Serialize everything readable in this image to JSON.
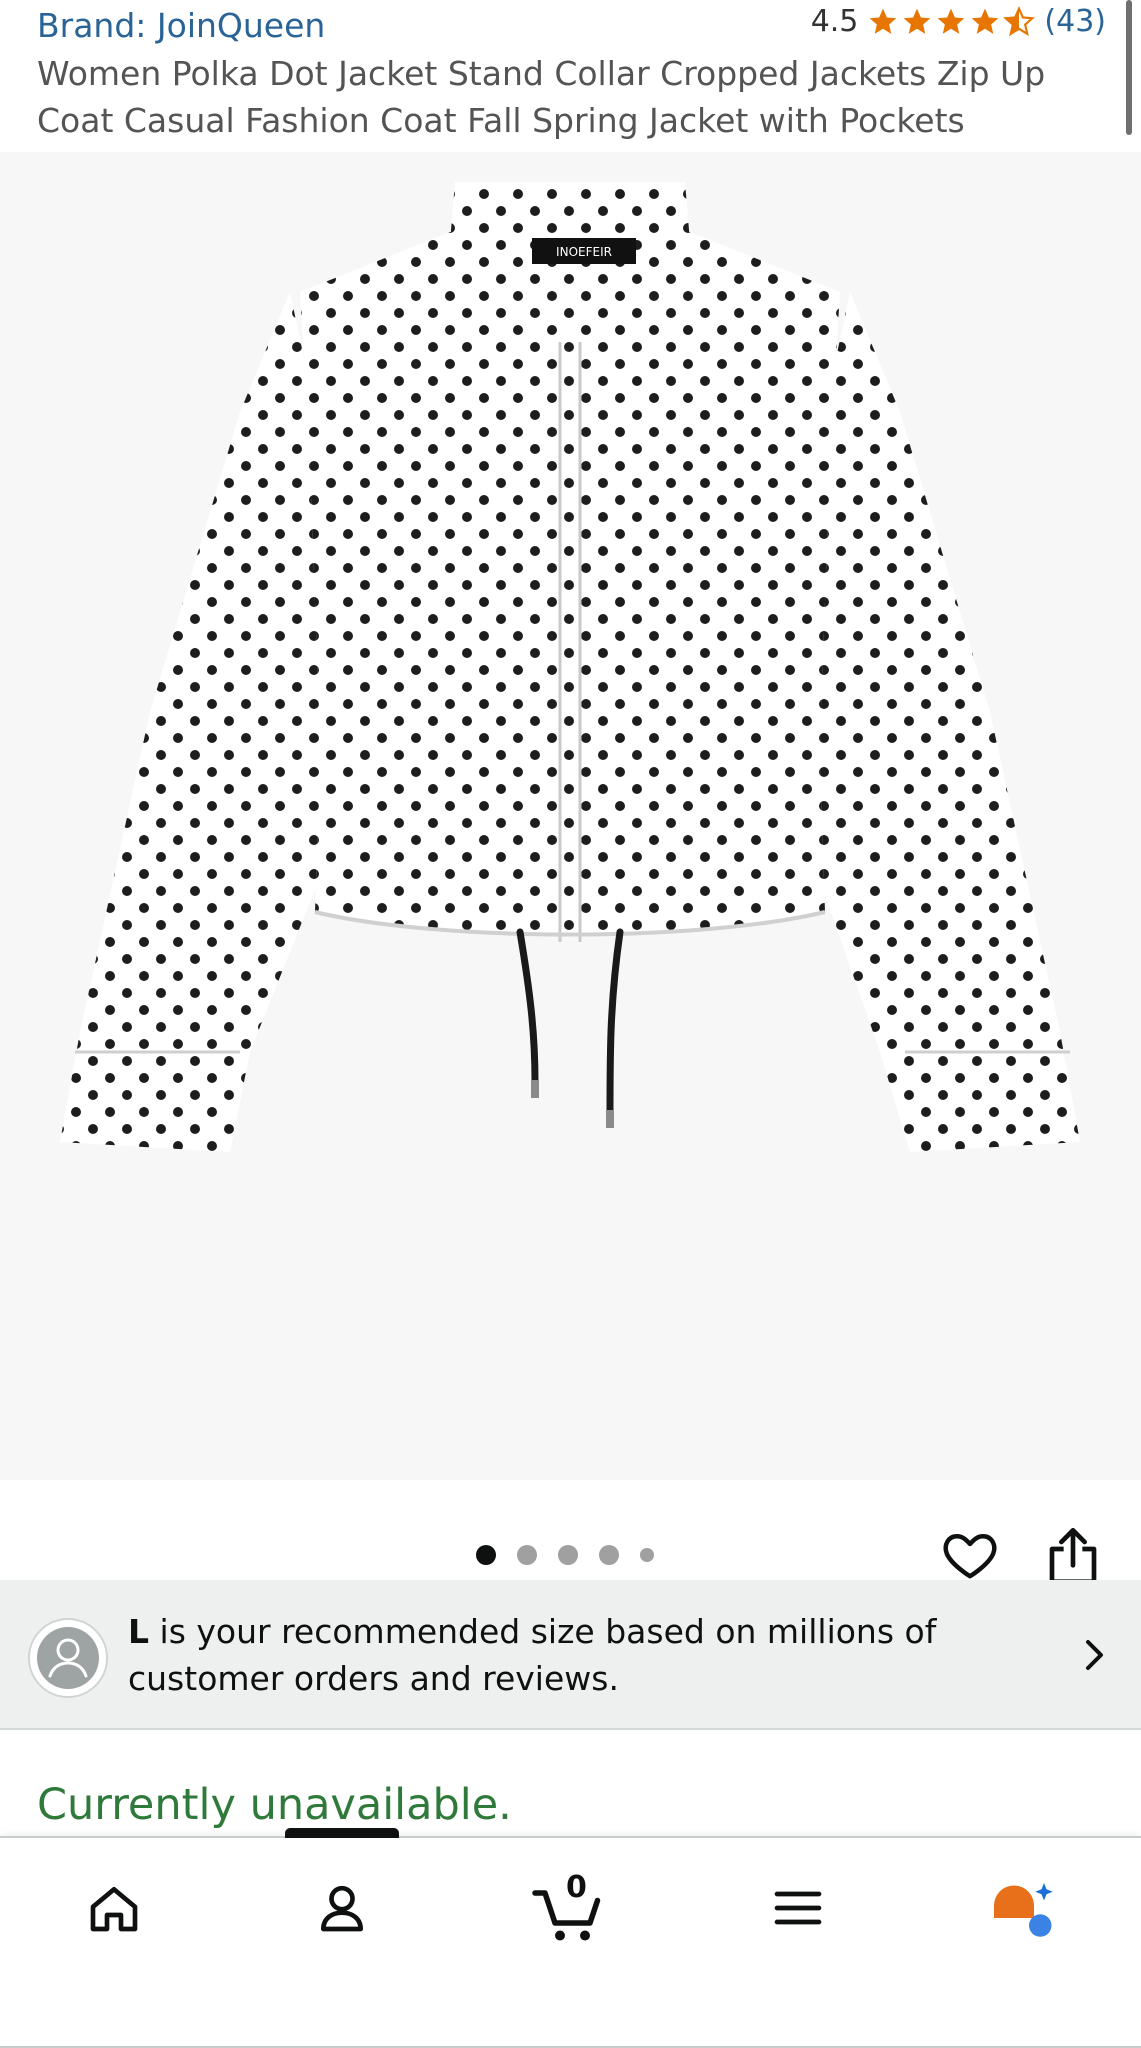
{
  "product": {
    "brand": "Brand: JoinQueen",
    "rating": "4.5",
    "stars": 4.5,
    "review_count": "(43)",
    "title": "Women Polka Dot Jacket Stand Collar Cropped Jackets Zip Up Coat Casual Fashion Coat Fall Spring Jacket with Pockets",
    "collar_label": "INOEFEIR"
  },
  "carousel": {
    "image_count": 5,
    "active_index": 0
  },
  "size_recommendation": {
    "size": "L",
    "text": " is your recommended size based on millions of customer orders and reviews."
  },
  "availability": {
    "status": "Currently unavailable."
  },
  "bottom_nav": {
    "items": [
      "home-icon",
      "account-icon",
      "cart-icon",
      "menu-icon",
      "rufus-icon"
    ],
    "cart_count": "0"
  },
  "colors": {
    "link": "#2a6496",
    "star": "#e77600",
    "unavailable": "#2f7a3b"
  }
}
